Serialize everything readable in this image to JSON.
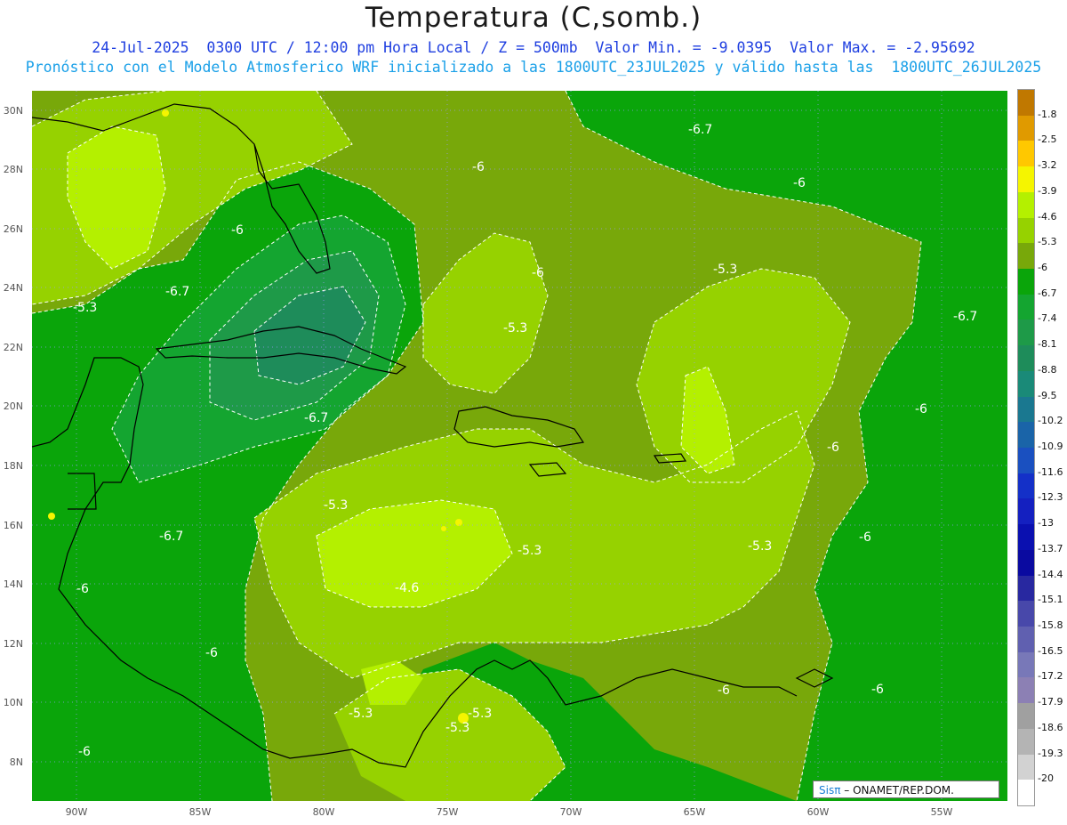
{
  "title": "Temperatura (C,somb.)",
  "subtitle_line1": "24-Jul-2025  0300 UTC / 12:00 pm Hora Local / Z = 500mb  Valor Min. = -9.0395  Valor Max. = -2.95692",
  "subtitle_line2": "Pronóstico con el Modelo Atmosferico WRF inicializado a las 1800UTC_23JUL2025 y válido hasta las  1800UTC_26JUL2025",
  "lat_labels": [
    "30N",
    "28N",
    "26N",
    "24N",
    "22N",
    "20N",
    "18N",
    "16N",
    "14N",
    "12N",
    "10N",
    "8N"
  ],
  "lon_labels": [
    "90W",
    "85W",
    "80W",
    "75W",
    "70W",
    "65W",
    "60W",
    "55W"
  ],
  "colorbar": [
    {
      "label": "-1.8",
      "color": "#c07800"
    },
    {
      "label": "-2.5",
      "color": "#e09a00"
    },
    {
      "label": "-3.2",
      "color": "#ffc800"
    },
    {
      "label": "-3.9",
      "color": "#f5f500"
    },
    {
      "label": "-4.6",
      "color": "#b4f000"
    },
    {
      "label": "-5.3",
      "color": "#96d200"
    },
    {
      "label": "-6",
      "color": "#78a80a"
    },
    {
      "label": "-6.7",
      "color": "#0aa50a"
    },
    {
      "label": "-7.4",
      "color": "#14a530"
    },
    {
      "label": "-8.1",
      "color": "#1e9a48"
    },
    {
      "label": "-8.8",
      "color": "#1e8c5a"
    },
    {
      "label": "-9.5",
      "color": "#1a8a78"
    },
    {
      "label": "-10.2",
      "color": "#1a7890"
    },
    {
      "label": "-10.9",
      "color": "#1a64a8"
    },
    {
      "label": "-11.6",
      "color": "#1a50c0"
    },
    {
      "label": "-12.3",
      "color": "#1430c8"
    },
    {
      "label": "-13",
      "color": "#1420c0"
    },
    {
      "label": "-13.7",
      "color": "#0a10b0"
    },
    {
      "label": "-14.4",
      "color": "#0a0aa0"
    },
    {
      "label": "-15.1",
      "color": "#2828a0"
    },
    {
      "label": "-15.8",
      "color": "#4848aa"
    },
    {
      "label": "-16.5",
      "color": "#6060b0"
    },
    {
      "label": "-17.2",
      "color": "#7878b8"
    },
    {
      "label": "-17.9",
      "color": "#8c80b4"
    },
    {
      "label": "-18.6",
      "color": "#a0a0a0"
    },
    {
      "label": "-19.3",
      "color": "#b4b4b4"
    },
    {
      "label": "-20",
      "color": "#d2d2d2"
    },
    {
      "label": "",
      "color": "#ffffff"
    }
  ],
  "contour_labels": [
    "-6.7",
    "-6",
    "-6",
    "-6",
    "-5.3",
    "-6",
    "-6.7",
    "-5.3",
    "-6.7",
    "-5.3",
    "-6",
    "-6",
    "-6.7",
    "-5.3",
    "-6.7",
    "-5.3",
    "-5.3",
    "-6",
    "-6",
    "-4.6",
    "-6",
    "-6",
    "-6",
    "-5.3",
    "-5.3",
    "-5.3",
    "-6"
  ],
  "credit_sis": "Sisπ",
  "credit_text": " – ONAMET/REP.DOM."
}
